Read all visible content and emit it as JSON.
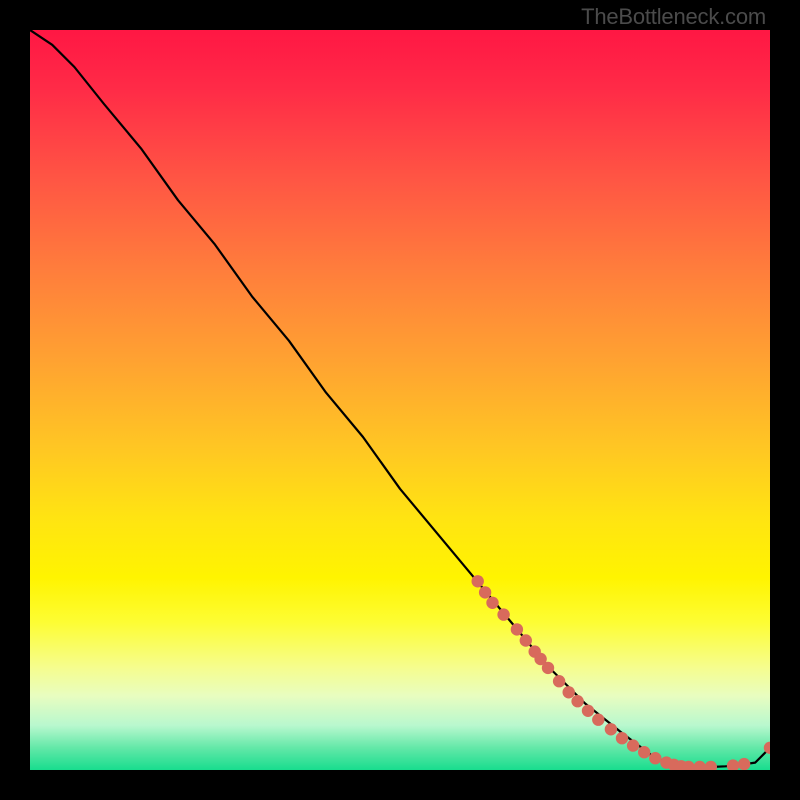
{
  "watermark": "TheBottleneck.com",
  "colors": {
    "curve": "#000000",
    "marker_fill": "#d86a5c",
    "marker_stroke": "#c55a4d",
    "background": "#000000"
  },
  "chart_data": {
    "type": "line",
    "title": "",
    "xlabel": "",
    "ylabel": "",
    "xlim": [
      0,
      100
    ],
    "ylim": [
      0,
      100
    ],
    "gradient_stops": [
      {
        "pos": 0,
        "color": "#ff1744"
      },
      {
        "pos": 20,
        "color": "#ff5544"
      },
      {
        "pos": 44,
        "color": "#ffa032"
      },
      {
        "pos": 66,
        "color": "#ffe412"
      },
      {
        "pos": 86,
        "color": "#f6fd8c"
      },
      {
        "pos": 100,
        "color": "#18dd8e"
      }
    ],
    "series": [
      {
        "name": "bottleneck-curve",
        "x": [
          0,
          3,
          6,
          10,
          15,
          20,
          25,
          30,
          35,
          40,
          45,
          50,
          55,
          60,
          65,
          70,
          75,
          80,
          84,
          86,
          88,
          90,
          92,
          94,
          96,
          98,
          100
        ],
        "y": [
          100,
          98,
          95,
          90,
          84,
          77,
          71,
          64,
          58,
          51,
          45,
          38,
          32,
          26,
          20,
          14,
          9,
          5,
          2,
          1,
          0.6,
          0.4,
          0.4,
          0.5,
          0.7,
          1.0,
          3
        ]
      }
    ],
    "markers": [
      {
        "x": 60.5,
        "y": 25.5
      },
      {
        "x": 61.5,
        "y": 24.0
      },
      {
        "x": 62.5,
        "y": 22.6
      },
      {
        "x": 64.0,
        "y": 21.0
      },
      {
        "x": 65.8,
        "y": 19.0
      },
      {
        "x": 67.0,
        "y": 17.5
      },
      {
        "x": 68.2,
        "y": 16.0
      },
      {
        "x": 69.0,
        "y": 15.0
      },
      {
        "x": 70.0,
        "y": 13.8
      },
      {
        "x": 71.5,
        "y": 12.0
      },
      {
        "x": 72.8,
        "y": 10.5
      },
      {
        "x": 74.0,
        "y": 9.3
      },
      {
        "x": 75.4,
        "y": 8.0
      },
      {
        "x": 76.8,
        "y": 6.8
      },
      {
        "x": 78.5,
        "y": 5.5
      },
      {
        "x": 80.0,
        "y": 4.3
      },
      {
        "x": 81.5,
        "y": 3.3
      },
      {
        "x": 83.0,
        "y": 2.4
      },
      {
        "x": 84.5,
        "y": 1.6
      },
      {
        "x": 86.0,
        "y": 1.0
      },
      {
        "x": 87.0,
        "y": 0.7
      },
      {
        "x": 88.0,
        "y": 0.5
      },
      {
        "x": 89.0,
        "y": 0.4
      },
      {
        "x": 90.5,
        "y": 0.4
      },
      {
        "x": 92.0,
        "y": 0.4
      },
      {
        "x": 95.0,
        "y": 0.6
      },
      {
        "x": 96.5,
        "y": 0.8
      },
      {
        "x": 100.0,
        "y": 3.0
      }
    ]
  }
}
